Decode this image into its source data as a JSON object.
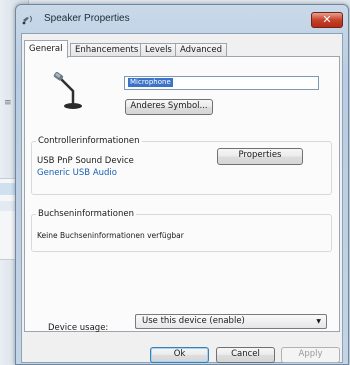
{
  "window": {
    "title": "Speaker Properties",
    "close_glyph": "✕"
  },
  "tabs": [
    {
      "label": "General",
      "active": true
    },
    {
      "label": "Enhancements",
      "active": false
    },
    {
      "label": "Levels",
      "active": false
    },
    {
      "label": "Advanced",
      "active": false
    }
  ],
  "general": {
    "device_name_value": "Microphone",
    "change_icon_button": "Anderes Symbol...",
    "controller": {
      "heading": "Controllerinformationen",
      "device": "USB PnP Sound Device",
      "driver_link": "Generic USB Audio",
      "properties_button": "Properties"
    },
    "jack": {
      "heading": "Buchseninformationen",
      "text": "Keine Buchseninformationen verfügbar"
    },
    "device_usage_label": "Device usage:",
    "device_usage_value": "Use this device (enable)"
  },
  "buttons": {
    "ok": "Ok",
    "cancel": "Cancel",
    "apply": "Apply"
  },
  "colors": {
    "link": "#1a5fb4",
    "selection": "#3b73c8",
    "close": "#c7412a"
  },
  "icons": {
    "title": "speaker-icon",
    "device": "microphone-icon",
    "dropdown": "chevron-down-icon"
  }
}
